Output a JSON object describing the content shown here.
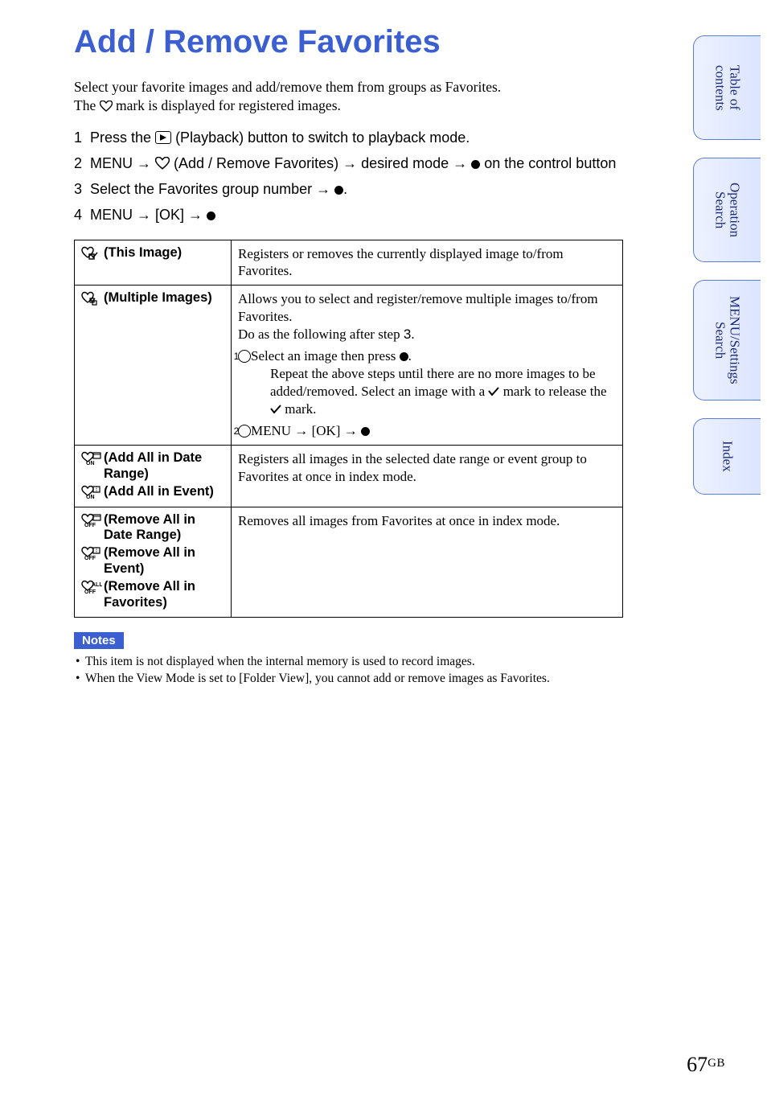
{
  "title": "Add / Remove Favorites",
  "intro_line1": "Select your favorite images and add/remove them from groups as Favorites.",
  "intro_line2a": "The ",
  "intro_line2b": " mark is displayed for registered images.",
  "steps": {
    "s1_num": "1",
    "s1_a": "Press the ",
    "s1_b": " (Playback) button to switch to playback mode.",
    "s2_num": "2",
    "s2_a": "MENU ",
    "s2_b": " (Add / Remove Favorites) ",
    "s2_c": " desired mode ",
    "s2_d": " on the control button",
    "s3_num": "3",
    "s3_a": "Select the Favorites group number ",
    "s3_b": ".",
    "s4_num": "4",
    "s4_a": "MENU ",
    "s4_b": " [OK] "
  },
  "table": {
    "r1_label": " (This Image)",
    "r1_desc": "Registers or removes the currently displayed image to/from Favorites.",
    "r2_label": " (Multiple Images)",
    "r2_desc_a": "Allows you to select and register/remove multiple images to/from Favorites.",
    "r2_desc_b": "Do as the following after step ",
    "r2_desc_b_num": "3",
    "r2_desc_b_end": ".",
    "r2_sub1_a": "Select an image then press ",
    "r2_sub1_b": ".",
    "r2_sub1_c": "Repeat the above steps until there are no more images to be added/removed. Select an image with a ",
    "r2_sub1_d": " mark to release the ",
    "r2_sub1_e": " mark.",
    "r2_sub2_a": "MENU ",
    "r2_sub2_b": " [OK] ",
    "r3_label_a": " (Add All in Date Range)",
    "r3_label_b": " (Add All in Event)",
    "r3_desc": "Registers all images in the selected date range or event group to Favorites at once in index mode.",
    "r4_label_a": " (Remove All in Date Range)",
    "r4_label_b": " (Remove All in Event)",
    "r4_label_c": " (Remove All in Favorites)",
    "r4_desc": "Removes all images from Favorites at once in index mode."
  },
  "notes_header": "Notes",
  "notes": [
    "This item is not displayed when the internal memory is used to record images.",
    "When the View Mode is set to [Folder View], you cannot add or remove images as Favorites."
  ],
  "tabs": {
    "toc": "Table of\ncontents",
    "op": "Operation\nSearch",
    "menu": "MENU/Settings\nSearch",
    "index": "Index"
  },
  "page_number": "67",
  "page_suffix": "GB",
  "circ1": "1",
  "circ2": "2",
  "arrow": "→"
}
